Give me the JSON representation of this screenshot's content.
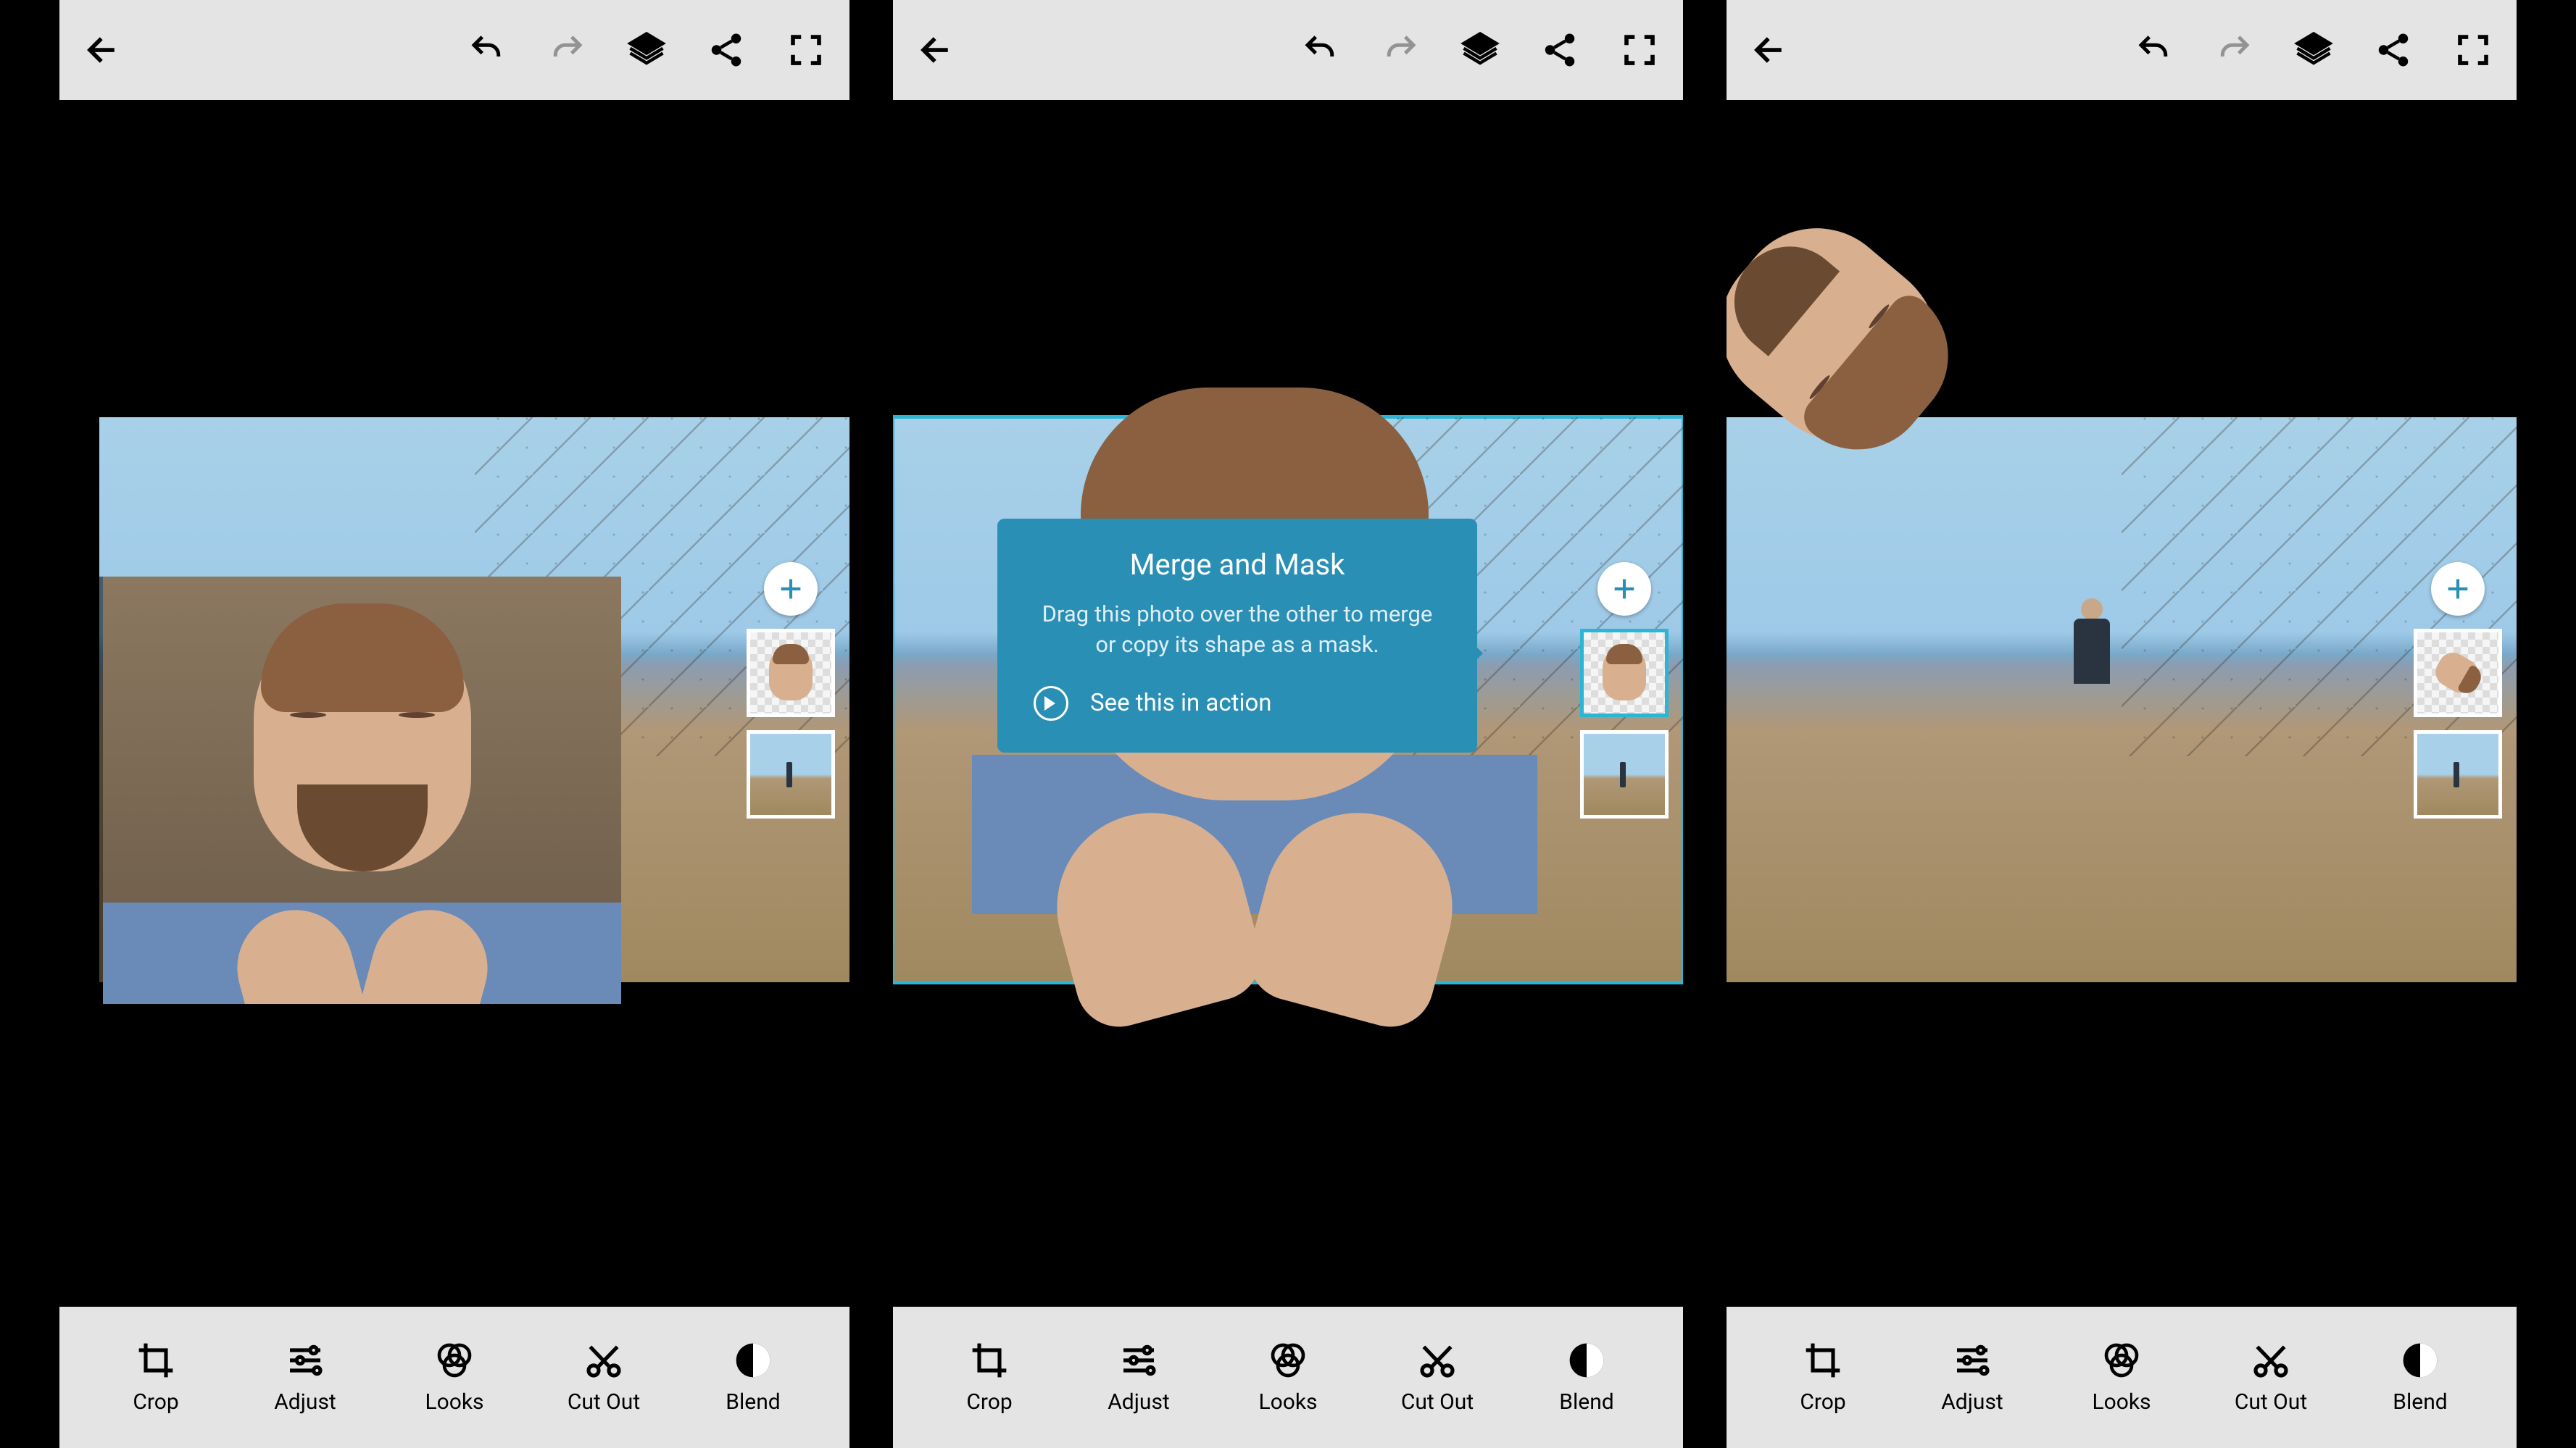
{
  "topbar": {
    "back": "Back",
    "undo": "Undo",
    "redo": "Redo",
    "layers": "Layers",
    "share": "Share",
    "fullscreen": "Fullscreen"
  },
  "tools": {
    "crop": "Crop",
    "adjust": "Adjust",
    "looks": "Looks",
    "cutout": "Cut Out",
    "blend": "Blend"
  },
  "tooltip": {
    "title": "Merge and Mask",
    "body": "Drag this photo over the other to merge or copy its shape as a mask.",
    "action": "See this in action"
  },
  "layerPanel": {
    "add": "+"
  },
  "colors": {
    "accent": "#2db5d6",
    "tooltipBg": "#2a8fb5",
    "barBg": "#e4e4e4"
  }
}
